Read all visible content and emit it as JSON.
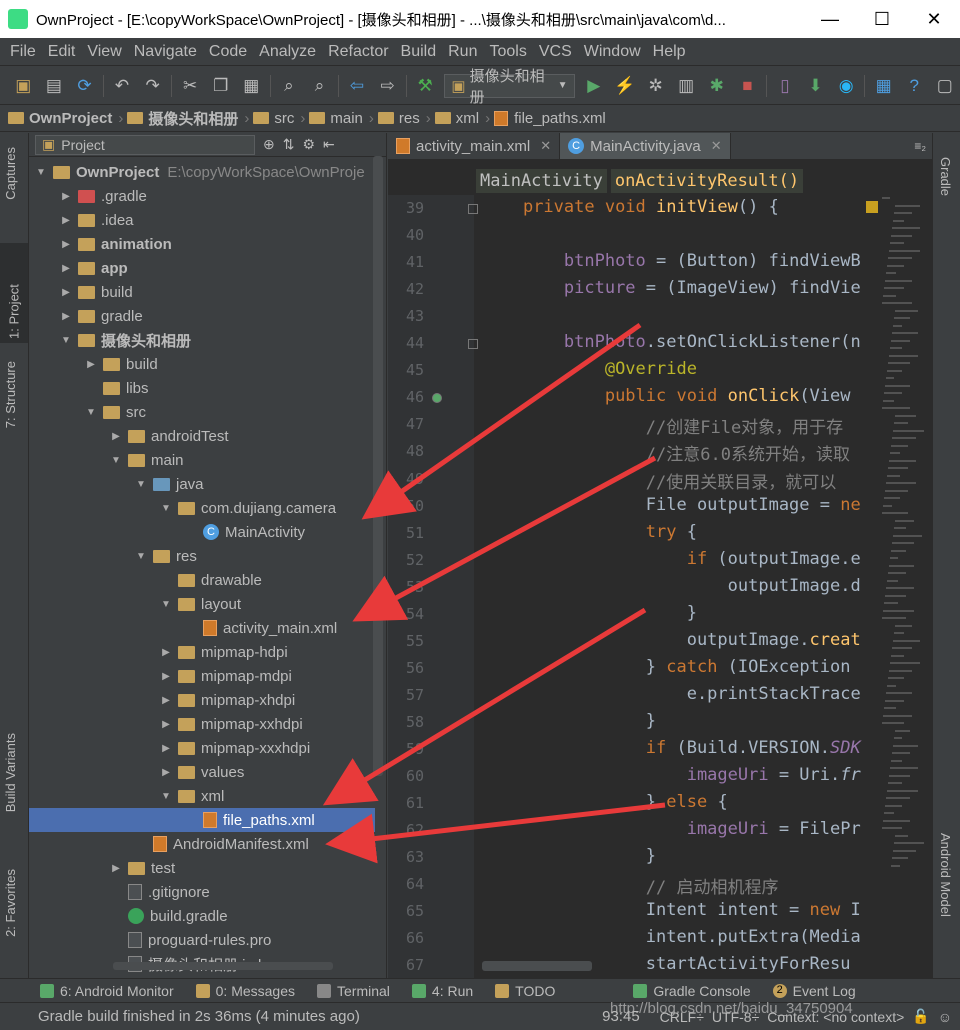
{
  "window": {
    "title": "OwnProject - [E:\\copyWorkSpace\\OwnProject] - [摄像头和相册] - ...\\摄像头和相册\\src\\main\\java\\com\\d...",
    "minimize": "—",
    "maximize": "☐",
    "close": "✕"
  },
  "menu": [
    "File",
    "Edit",
    "View",
    "Navigate",
    "Code",
    "Analyze",
    "Refactor",
    "Build",
    "Run",
    "Tools",
    "VCS",
    "Window",
    "Help"
  ],
  "toolbar": {
    "run_config": "摄像头和相册"
  },
  "breadcrumb": [
    "OwnProject",
    "摄像头和相册",
    "src",
    "main",
    "res",
    "xml",
    "file_paths.xml"
  ],
  "left_tool_tabs": [
    "Captures",
    "1: Project",
    "7: Structure",
    "Build Variants",
    "2: Favorites"
  ],
  "right_tool_tabs": [
    "Gradle",
    "Android Model"
  ],
  "project_panel": {
    "view_selector": "Project",
    "tree": [
      {
        "label": "OwnProject",
        "detail": "E:\\copyWorkSpace\\OwnProje",
        "depth": 0,
        "arrow": "▼",
        "icon": "folder",
        "bold": true
      },
      {
        "label": ".gradle",
        "depth": 1,
        "arrow": "▶",
        "icon": "folder-red"
      },
      {
        "label": ".idea",
        "depth": 1,
        "arrow": "▶",
        "icon": "folder"
      },
      {
        "label": "animation",
        "depth": 1,
        "arrow": "▶",
        "icon": "folder",
        "bold": true
      },
      {
        "label": "app",
        "depth": 1,
        "arrow": "▶",
        "icon": "folder",
        "bold": true
      },
      {
        "label": "build",
        "depth": 1,
        "arrow": "▶",
        "icon": "folder"
      },
      {
        "label": "gradle",
        "depth": 1,
        "arrow": "▶",
        "icon": "folder"
      },
      {
        "label": "摄像头和相册",
        "depth": 1,
        "arrow": "▼",
        "icon": "folder",
        "bold": true
      },
      {
        "label": "build",
        "depth": 2,
        "arrow": "▶",
        "icon": "folder"
      },
      {
        "label": "libs",
        "depth": 2,
        "arrow": "",
        "icon": "folder"
      },
      {
        "label": "src",
        "depth": 2,
        "arrow": "▼",
        "icon": "folder"
      },
      {
        "label": "androidTest",
        "depth": 3,
        "arrow": "▶",
        "icon": "folder"
      },
      {
        "label": "main",
        "depth": 3,
        "arrow": "▼",
        "icon": "folder"
      },
      {
        "label": "java",
        "depth": 4,
        "arrow": "▼",
        "icon": "folder-blue"
      },
      {
        "label": "com.dujiang.camera",
        "depth": 5,
        "arrow": "▼",
        "icon": "folder"
      },
      {
        "label": "MainActivity",
        "depth": 6,
        "arrow": "",
        "icon": "class"
      },
      {
        "label": "res",
        "depth": 4,
        "arrow": "▼",
        "icon": "folder"
      },
      {
        "label": "drawable",
        "depth": 5,
        "arrow": "",
        "icon": "folder"
      },
      {
        "label": "layout",
        "depth": 5,
        "arrow": "▼",
        "icon": "folder"
      },
      {
        "label": "activity_main.xml",
        "depth": 6,
        "arrow": "",
        "icon": "xml"
      },
      {
        "label": "mipmap-hdpi",
        "depth": 5,
        "arrow": "▶",
        "icon": "folder"
      },
      {
        "label": "mipmap-mdpi",
        "depth": 5,
        "arrow": "▶",
        "icon": "folder"
      },
      {
        "label": "mipmap-xhdpi",
        "depth": 5,
        "arrow": "▶",
        "icon": "folder"
      },
      {
        "label": "mipmap-xxhdpi",
        "depth": 5,
        "arrow": "▶",
        "icon": "folder"
      },
      {
        "label": "mipmap-xxxhdpi",
        "depth": 5,
        "arrow": "▶",
        "icon": "folder"
      },
      {
        "label": "values",
        "depth": 5,
        "arrow": "▶",
        "icon": "folder"
      },
      {
        "label": "xml",
        "depth": 5,
        "arrow": "▼",
        "icon": "folder"
      },
      {
        "label": "file_paths.xml",
        "depth": 6,
        "arrow": "",
        "icon": "xml",
        "selected": true
      },
      {
        "label": "AndroidManifest.xml",
        "depth": 4,
        "arrow": "",
        "icon": "xml"
      },
      {
        "label": "test",
        "depth": 3,
        "arrow": "▶",
        "icon": "folder"
      },
      {
        "label": ".gitignore",
        "depth": 3,
        "arrow": "",
        "icon": "file"
      },
      {
        "label": "build.gradle",
        "depth": 3,
        "arrow": "",
        "icon": "gradle"
      },
      {
        "label": "proguard-rules.pro",
        "depth": 3,
        "arrow": "",
        "icon": "file"
      },
      {
        "label": "摄像头和相册.iml",
        "depth": 3,
        "arrow": "",
        "icon": "file"
      }
    ]
  },
  "editor": {
    "tabs": [
      {
        "label": "activity_main.xml",
        "active": false
      },
      {
        "label": "MainActivity.java",
        "active": true
      }
    ],
    "tab_overflow": "≡₂",
    "crumbs": [
      "MainActivity",
      "onActivityResult()"
    ],
    "lines": [
      {
        "n": "39",
        "tokens": [
          [
            "    ",
            ""
          ],
          [
            "private void ",
            "kw"
          ],
          [
            "initView",
            "fn"
          ],
          [
            "() {",
            ""
          ]
        ]
      },
      {
        "n": "40",
        "tokens": []
      },
      {
        "n": "41",
        "tokens": [
          [
            "        ",
            ""
          ],
          [
            "btnPhoto",
            "fld"
          ],
          [
            " = (Button) findViewB",
            ""
          ]
        ]
      },
      {
        "n": "42",
        "tokens": [
          [
            "        ",
            ""
          ],
          [
            "picture",
            "fld"
          ],
          [
            " = (ImageView) findVie",
            ""
          ]
        ]
      },
      {
        "n": "43",
        "tokens": []
      },
      {
        "n": "44",
        "tokens": [
          [
            "        ",
            ""
          ],
          [
            "btnPhoto",
            "fld"
          ],
          [
            ".setOnClickListener(n",
            ""
          ]
        ]
      },
      {
        "n": "45",
        "tokens": [
          [
            "            ",
            ""
          ],
          [
            "@Override",
            "an"
          ]
        ]
      },
      {
        "n": "46",
        "tokens": [
          [
            "            ",
            ""
          ],
          [
            "public void ",
            "kw"
          ],
          [
            "onClick",
            "fn"
          ],
          [
            "(View",
            ""
          ]
        ]
      },
      {
        "n": "47",
        "tokens": [
          [
            "                ",
            ""
          ],
          [
            "//创建File对象，用于存",
            "cm"
          ]
        ]
      },
      {
        "n": "48",
        "tokens": [
          [
            "                ",
            ""
          ],
          [
            "//注意6.0系统开始，读取",
            "cm"
          ]
        ]
      },
      {
        "n": "49",
        "tokens": [
          [
            "                ",
            ""
          ],
          [
            "//使用关联目录，就可以",
            "cm"
          ]
        ]
      },
      {
        "n": "50",
        "tokens": [
          [
            "                ",
            ""
          ],
          [
            "File outputImage = ",
            ""
          ],
          [
            "ne",
            "kw"
          ]
        ]
      },
      {
        "n": "51",
        "tokens": [
          [
            "                ",
            ""
          ],
          [
            "try",
            "kw"
          ],
          [
            " {",
            ""
          ]
        ]
      },
      {
        "n": "52",
        "tokens": [
          [
            "                    ",
            ""
          ],
          [
            "if",
            "kw"
          ],
          [
            " (outputImage.e",
            ""
          ]
        ]
      },
      {
        "n": "53",
        "tokens": [
          [
            "                        ",
            ""
          ],
          [
            "outputImage.d",
            ""
          ]
        ]
      },
      {
        "n": "54",
        "tokens": [
          [
            "                    ",
            ""
          ],
          [
            "}",
            ""
          ]
        ]
      },
      {
        "n": "55",
        "tokens": [
          [
            "                    ",
            ""
          ],
          [
            "outputImage.",
            ""
          ],
          [
            "creat",
            "fn"
          ]
        ]
      },
      {
        "n": "56",
        "tokens": [
          [
            "                ",
            ""
          ],
          [
            "} ",
            ""
          ],
          [
            "catch",
            "kw"
          ],
          [
            " (IOException",
            ""
          ]
        ]
      },
      {
        "n": "57",
        "tokens": [
          [
            "                    ",
            ""
          ],
          [
            "e.printStackTrace",
            ""
          ]
        ]
      },
      {
        "n": "58",
        "tokens": [
          [
            "                ",
            ""
          ],
          [
            "}",
            ""
          ]
        ]
      },
      {
        "n": "59",
        "tokens": [
          [
            "                ",
            ""
          ],
          [
            "if",
            "kw"
          ],
          [
            " (Build.VERSION.",
            ""
          ],
          [
            "SDK",
            "fld it"
          ]
        ]
      },
      {
        "n": "60",
        "tokens": [
          [
            "                    ",
            ""
          ],
          [
            "imageUri",
            "fld"
          ],
          [
            " = Uri.",
            ""
          ],
          [
            "fr",
            "it"
          ]
        ]
      },
      {
        "n": "61",
        "tokens": [
          [
            "                ",
            ""
          ],
          [
            "} ",
            ""
          ],
          [
            "else",
            "kw"
          ],
          [
            " {",
            ""
          ]
        ]
      },
      {
        "n": "62",
        "tokens": [
          [
            "                    ",
            ""
          ],
          [
            "imageUri",
            "fld"
          ],
          [
            " = FilePr",
            ""
          ]
        ]
      },
      {
        "n": "63",
        "tokens": [
          [
            "                ",
            ""
          ],
          [
            "}",
            ""
          ]
        ]
      },
      {
        "n": "64",
        "tokens": [
          [
            "                ",
            ""
          ],
          [
            "// 启动相机程序",
            "cm"
          ]
        ]
      },
      {
        "n": "65",
        "tokens": [
          [
            "                ",
            ""
          ],
          [
            "Intent intent = ",
            ""
          ],
          [
            "new ",
            "kw"
          ],
          [
            "I",
            ""
          ]
        ]
      },
      {
        "n": "66",
        "tokens": [
          [
            "                ",
            ""
          ],
          [
            "intent.putExtra(Media",
            ""
          ]
        ]
      },
      {
        "n": "67",
        "tokens": [
          [
            "                ",
            ""
          ],
          [
            "startActivityForResu",
            ""
          ]
        ]
      }
    ]
  },
  "bottom_tabs": [
    {
      "label": "6: Android Monitor"
    },
    {
      "label": "0: Messages"
    },
    {
      "label": "Terminal"
    },
    {
      "label": "4: Run"
    },
    {
      "label": "TODO"
    },
    {
      "label": "Gradle Console"
    },
    {
      "label": "Event Log",
      "badge": "2"
    }
  ],
  "status": {
    "message": "Gradle build finished in 2s 36ms (4 minutes ago)",
    "position": "93:45",
    "line_sep": "CRLF÷",
    "encoding": "UTF-8÷",
    "context": "Context: <no context>"
  },
  "watermark": "http://blog.csdn.net/baidu_34750904",
  "colors": {
    "annotation_arrow": "#e83a3a",
    "selection": "#4b6eaf",
    "keyword": "#cc7832",
    "field": "#9876aa",
    "method": "#ffc66d",
    "comment": "#808080"
  }
}
